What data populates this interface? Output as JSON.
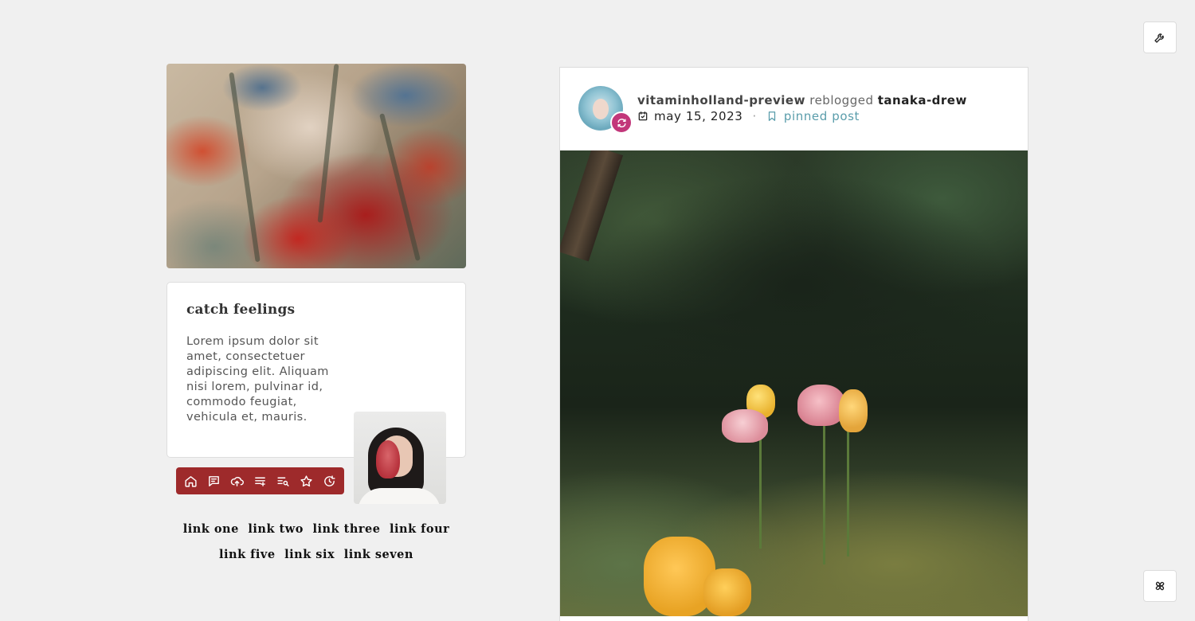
{
  "toolbar": {
    "customize_icon": "wrench-icon",
    "theme_icon": "pinwheel-icon"
  },
  "sidebar": {
    "title": "catch feelings",
    "description": "Lorem ipsum dolor sit amet, consectetuer adipiscing elit. Aliquam nisi lorem, pulvinar id, commodo feugiat, vehicula et, mauris.",
    "nav_icons": [
      "home-icon",
      "message-icon",
      "upload-cloud-icon",
      "list-add-icon",
      "search-list-icon",
      "star-icon",
      "refresh-icon"
    ],
    "links": [
      "link one",
      "link two",
      "link three",
      "link four",
      "link five",
      "link six",
      "link seven"
    ],
    "accent_color": "#9e2a2b"
  },
  "post": {
    "username": "vitaminholland-preview",
    "action": "reblogged",
    "source_user": "tanaka-drew",
    "date": "may 15, 2023",
    "separator": "·",
    "pinned_label": "pinned post",
    "reblog_badge_color": "#c2377a",
    "pinned_color": "#5a9dab"
  }
}
